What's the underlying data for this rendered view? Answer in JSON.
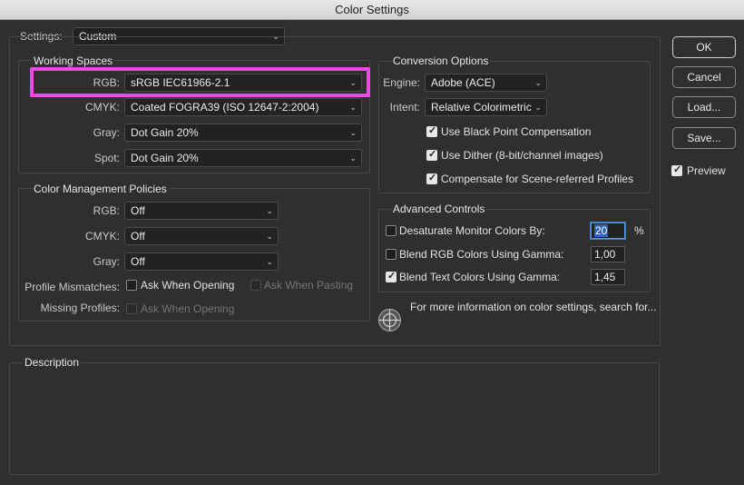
{
  "window": {
    "title": "Color Settings"
  },
  "settings": {
    "label": "Settings:",
    "value": "Custom"
  },
  "working_spaces": {
    "title": "Working Spaces",
    "rgb": {
      "label": "RGB:",
      "value": "sRGB IEC61966-2.1"
    },
    "cmyk": {
      "label": "CMYK:",
      "value": "Coated FOGRA39 (ISO 12647-2:2004)"
    },
    "gray": {
      "label": "Gray:",
      "value": "Dot Gain 20%"
    },
    "spot": {
      "label": "Spot:",
      "value": "Dot Gain 20%"
    }
  },
  "policies": {
    "title": "Color Management Policies",
    "rgb": {
      "label": "RGB:",
      "value": "Off"
    },
    "cmyk": {
      "label": "CMYK:",
      "value": "Off"
    },
    "gray": {
      "label": "Gray:",
      "value": "Off"
    },
    "mismatch_label": "Profile Mismatches:",
    "ask_opening": "Ask When Opening",
    "ask_pasting": "Ask When Pasting",
    "missing_label": "Missing Profiles:",
    "missing_ask_opening": "Ask When Opening"
  },
  "conversion": {
    "title": "Conversion Options",
    "engine": {
      "label": "Engine:",
      "value": "Adobe (ACE)"
    },
    "intent": {
      "label": "Intent:",
      "value": "Relative Colorimetric"
    },
    "black_point": "Use Black Point Compensation",
    "dither": "Use Dither (8-bit/channel images)",
    "scene": "Compensate for Scene-referred Profiles"
  },
  "advanced": {
    "title": "Advanced Controls",
    "desaturate": {
      "label": "Desaturate Monitor Colors By:",
      "value": "20",
      "unit": "%"
    },
    "blend_rgb": {
      "label": "Blend RGB Colors Using Gamma:",
      "value": "1,00"
    },
    "blend_text": {
      "label": "Blend Text Colors Using Gamma:",
      "value": "1,45"
    }
  },
  "info_text": "For more information on color settings, search for...",
  "description": {
    "title": "Description"
  },
  "buttons": {
    "ok": "OK",
    "cancel": "Cancel",
    "load": "Load...",
    "save": "Save...",
    "preview": "Preview"
  },
  "colors": {
    "highlight": "#f047e6",
    "focus": "#5a9bd6"
  }
}
